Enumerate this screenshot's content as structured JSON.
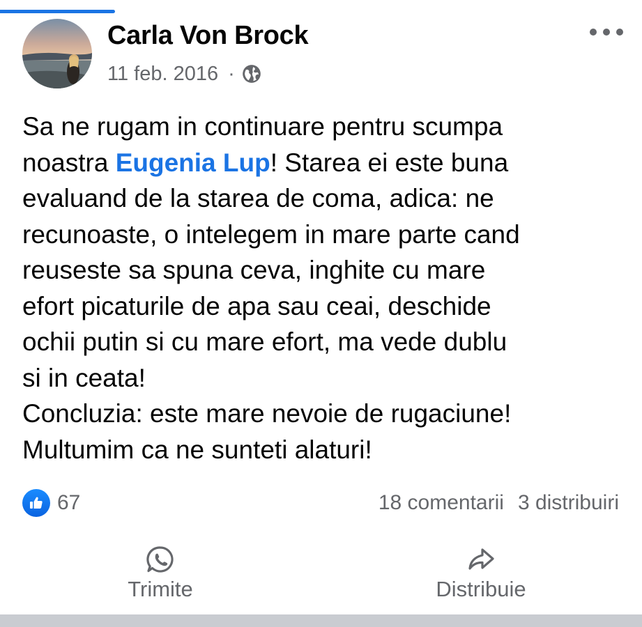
{
  "post": {
    "author": "Carla Von Brock",
    "date": "11 feb. 2016",
    "separator": "·",
    "privacy_icon": "globe-icon",
    "text_lines": [
      {
        "before": "Sa ne rugam in continuare pentru scumpa",
        "mention": "",
        "after": ""
      },
      {
        "before": "noastra ",
        "mention": "Eugenia Lup",
        "after": "! Starea ei este buna"
      },
      {
        "before": "evaluand de la starea de coma, adica: ne",
        "mention": "",
        "after": ""
      },
      {
        "before": "recunoaste, o intelegem in mare parte cand",
        "mention": "",
        "after": ""
      },
      {
        "before": "reuseste sa spuna ceva, inghite cu mare",
        "mention": "",
        "after": ""
      },
      {
        "before": "efort picaturile de apa sau ceai, deschide",
        "mention": "",
        "after": ""
      },
      {
        "before": "ochii putin si cu mare efort, ma vede dublu",
        "mention": "",
        "after": ""
      },
      {
        "before": "si in ceata!",
        "mention": "",
        "after": ""
      },
      {
        "before": "Concluzia: este mare nevoie de rugaciune!",
        "mention": "",
        "after": ""
      },
      {
        "before": "Multumim ca ne sunteti alaturi!",
        "mention": "",
        "after": ""
      }
    ]
  },
  "stats": {
    "reaction_icon": "like-icon",
    "reactions_count": "67",
    "comments": "18 comentarii",
    "shares": "3 distribuiri"
  },
  "actions": {
    "send_label": "Trimite",
    "send_icon": "whatsapp-icon",
    "share_label": "Distribuie",
    "share_icon": "share-arrow-icon"
  },
  "colors": {
    "accent": "#1b74e4",
    "secondary_text": "#65676b",
    "primary_text": "#050505",
    "separator": "#c9ccd1"
  }
}
